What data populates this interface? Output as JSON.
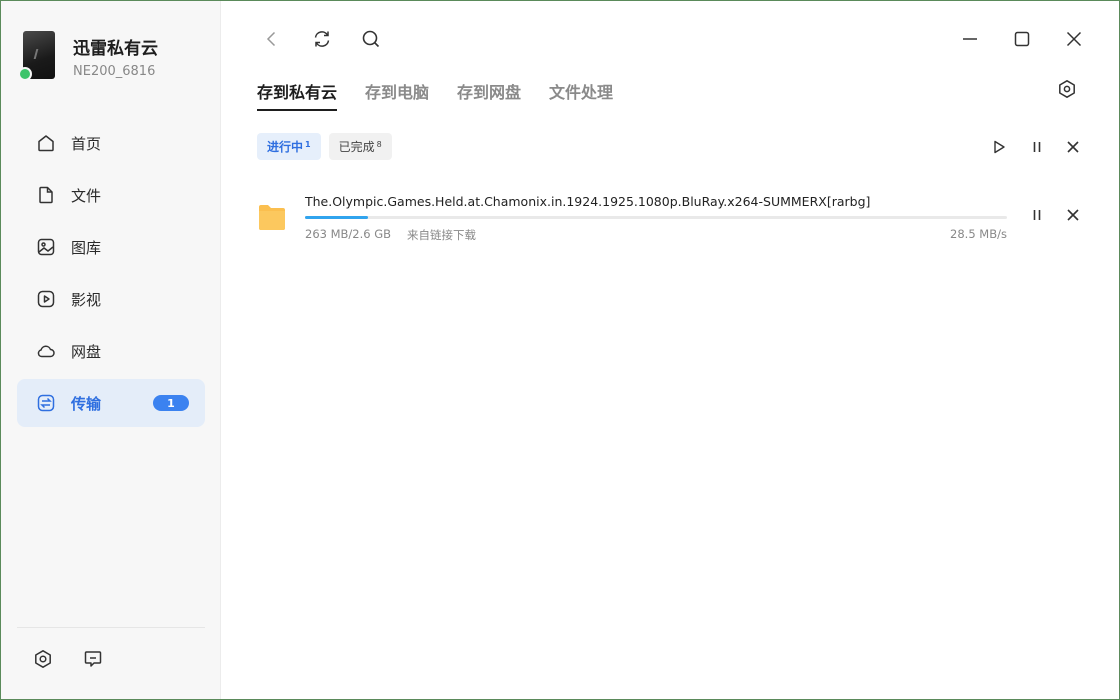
{
  "app": {
    "name": "迅雷私有云",
    "device_id": "NE200_6816"
  },
  "sidebar": {
    "items": [
      {
        "label": "首页",
        "icon": "home-icon"
      },
      {
        "label": "文件",
        "icon": "file-icon"
      },
      {
        "label": "图库",
        "icon": "gallery-icon"
      },
      {
        "label": "影视",
        "icon": "video-icon"
      },
      {
        "label": "网盘",
        "icon": "cloud-icon"
      },
      {
        "label": "传输",
        "icon": "transfer-icon",
        "badge": "1",
        "active": true
      }
    ],
    "bottom_icons": [
      "settings-hex-icon",
      "feedback-icon"
    ]
  },
  "tabs": [
    {
      "label": "存到私有云",
      "active": true
    },
    {
      "label": "存到电脑"
    },
    {
      "label": "存到网盘"
    },
    {
      "label": "文件处理"
    }
  ],
  "filters": [
    {
      "label": "进行中",
      "count": "1",
      "active": true
    },
    {
      "label": "已完成",
      "count": "8"
    }
  ],
  "tasks": [
    {
      "name": "The.Olympic.Games.Held.at.Chamonix.in.1924.1925.1080p.BluRay.x264-SUMMERX[rarbg]",
      "size": "263 MB/2.6 GB",
      "source": "来自链接下载",
      "speed": "28.5 MB/s",
      "progress": 0.09
    }
  ],
  "colors": {
    "accent": "#2f6fe0",
    "badge": "#3b82f0",
    "progress": "#31a4ee",
    "status_online": "#3dc46b",
    "folder": "#fbbf4f"
  }
}
